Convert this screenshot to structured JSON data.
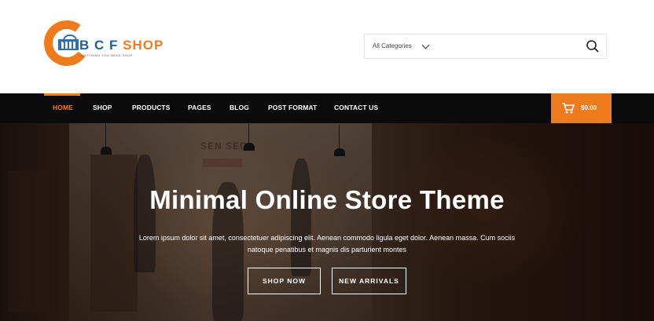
{
  "logo": {
    "brand_part1": "B C F",
    "brand_part2": "SHOP",
    "tagline": "ANYTHING YOU NEED SHOP"
  },
  "search": {
    "category_label": "All Categories",
    "placeholder": ""
  },
  "nav": {
    "items": [
      "HOME",
      "SHOP",
      "PRODUCTS",
      "PAGES",
      "BLOG",
      "POST FORMAT",
      "CONTACT US"
    ],
    "active": "HOME"
  },
  "cart": {
    "total": "$0.00"
  },
  "hero": {
    "sign": "SEN SEÇ",
    "title": "Minimal Online Store Theme",
    "text": "Lorem ipsum dolor sit amet, consectetuer adipiscing elit. Aenean commodo ligula eget dolor. Aenean massa. Cum sociis natoque penatibus et magnis dis parturient montes",
    "button_primary": "SHOP NOW",
    "button_secondary": "NEW ARRIVALS"
  },
  "colors": {
    "accent": "#f07b1c",
    "brand_blue": "#1f5f9e",
    "navbar_bg": "#0b0b0b"
  }
}
